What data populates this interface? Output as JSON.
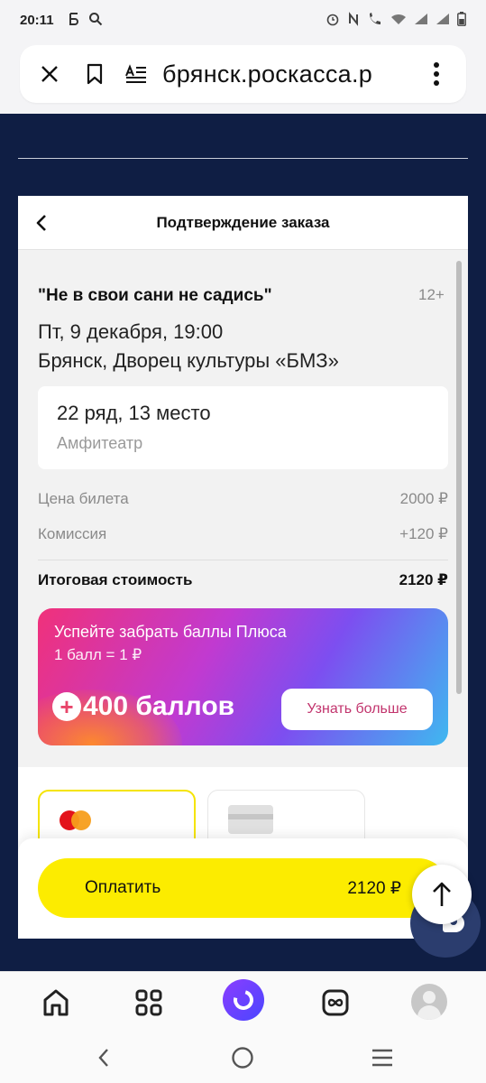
{
  "status_bar": {
    "time": "20:11",
    "left_icons": [
      "b-notification-icon",
      "search-icon"
    ],
    "right_icons": [
      "alarm-icon",
      "nfc-icon",
      "wifi-call-icon",
      "wifi-icon",
      "signal-icon",
      "signal-icon",
      "battery-icon"
    ]
  },
  "browser": {
    "url": "брянск.роскасса.р",
    "close_icon": "close-icon",
    "bookmark_icon": "bookmark-icon",
    "reader_icon": "reader-mode-icon",
    "menu_icon": "more-vert-icon"
  },
  "modal": {
    "title": "Подтверждение заказа",
    "event": {
      "name": "\"Не в свои сани не садись\"",
      "age": "12+",
      "date": "Пт, 9 декабря, 19:00",
      "venue": "Брянск, Дворец культуры «БМЗ»"
    },
    "seat": {
      "place": "22 ряд, 13 место",
      "zone": "Амфитеатр"
    },
    "price": {
      "ticket_label": "Цена билета",
      "ticket_value": "2000 ₽",
      "fee_label": "Комиссия",
      "fee_value": "+120 ₽",
      "total_label": "Итоговая стоимость",
      "total_value": "2120 ₽"
    },
    "plus": {
      "title": "Успейте забрать баллы Плюса",
      "rate": "1 балл = 1 ₽",
      "points": "400 баллов",
      "button": "Узнать больше"
    },
    "payment": {
      "pay_label": "Оплатить",
      "pay_amount": "2120 ₽"
    }
  },
  "colors": {
    "page_background": "#0f1e44",
    "pay_button": "#fcec00",
    "selected_card_border": "#f5e400",
    "plus_button_text": "#c2346d"
  }
}
